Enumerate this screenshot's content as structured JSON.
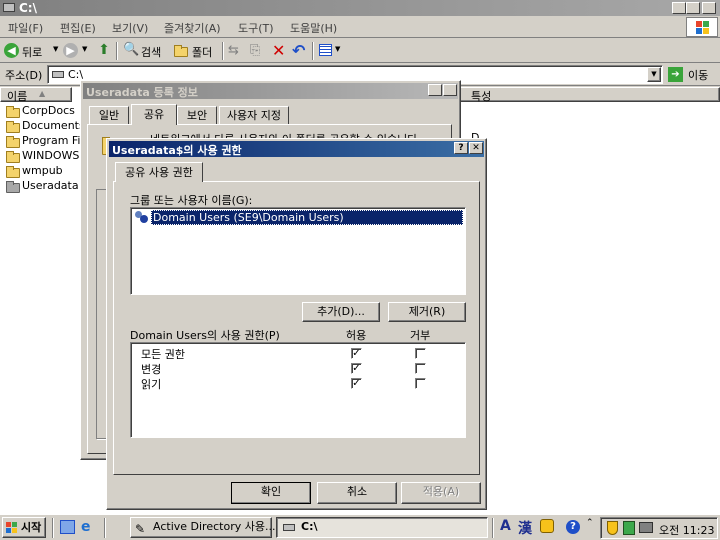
{
  "window": {
    "title": "C:\\",
    "controls": [
      "_",
      "❐",
      "✕"
    ]
  },
  "menu": {
    "items": [
      "파일(F)",
      "편집(E)",
      "보기(V)",
      "즐겨찾기(A)",
      "도구(T)",
      "도움말(H)"
    ]
  },
  "toolbar": {
    "back_label": "뒤로",
    "search_label": "검색",
    "folders_label": "폴더"
  },
  "address": {
    "label": "주소(D)",
    "value": "C:\\",
    "go_label": "이동"
  },
  "file_list": {
    "columns": {
      "name": "이름",
      "attributes": "특성"
    },
    "items": [
      "CorpDocs",
      "Documents",
      "Program Fil",
      "WINDOWS",
      "wmpub",
      "Useradata"
    ],
    "selected": "Useradata"
  },
  "props_dialog": {
    "title": "Useradata 등록 정보",
    "tabs": [
      "일반",
      "공유",
      "보안",
      "사용자 지정"
    ],
    "active_tab": "공유",
    "body_text": "네트워크에서 다른 사용자와 이 폴더를 공유할 수 있습니다."
  },
  "perm_dialog": {
    "title": "Useradata$의 사용 권한",
    "tab": "공유 사용 권한",
    "users_label": "그룹 또는 사용자 이름(G):",
    "users": [
      {
        "name": "Domain Users (SE9\\Domain Users)",
        "icon": "group-icon"
      }
    ],
    "add_button": "추가(D)...",
    "remove_button": "제거(R)",
    "perm_label": "Domain Users의 사용 권한(P)",
    "allow_header": "허용",
    "deny_header": "거부",
    "permissions": [
      {
        "name": "모든 권한",
        "allow": true,
        "deny": false
      },
      {
        "name": "변경",
        "allow": true,
        "deny": false
      },
      {
        "name": "읽기",
        "allow": true,
        "deny": false
      }
    ],
    "ok_button": "확인",
    "cancel_button": "취소",
    "apply_button": "적용(A)"
  },
  "taskbar": {
    "start_label": "시작",
    "tasks": [
      {
        "label": "Active Directory 사용...",
        "icon": "ad-icon"
      },
      {
        "label": "C:\\",
        "icon": "drive-icon"
      }
    ],
    "ime_mode": "A",
    "ime_hanja": "漢",
    "clock": "오전 11:23"
  },
  "colors": {
    "title_active": "#0a246a",
    "title_inactive": "#808080",
    "face": "#d4d0c8",
    "selection": "#0a246a"
  }
}
